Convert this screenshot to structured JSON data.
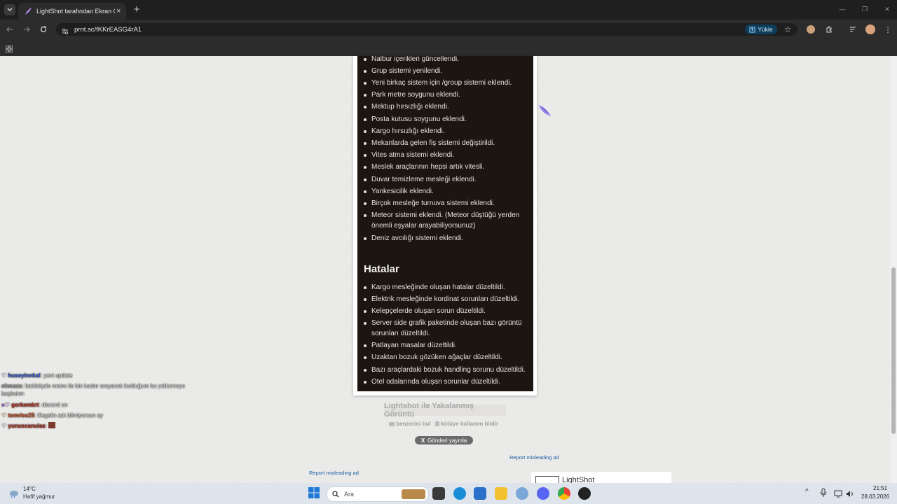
{
  "browser": {
    "tab_title": "LightShot tarafından Ekran Görüntüsü",
    "tab_close": "×",
    "new_tab": "+",
    "url": "prnt.sc/fKKrEASG4rA1",
    "upload_label": "Yükle",
    "window_minimize": "—",
    "window_restore": "❐",
    "window_close": "✕"
  },
  "screenshot": {
    "list1": [
      "Nalbur içerikleri güncellendi.",
      "Grup sistemi yenilendi.",
      "Yeni birkaç sistem için /group sistemi eklendi.",
      "Park metre soygunu eklendi.",
      "Mektup hırsızlığı eklendi.",
      "Posta kutusu soygunu eklendi.",
      "Kargo hırsızlığı eklendi.",
      "Mekanlarda gelen fiş sistemi değiştirildi.",
      "Vites atma sistemi eklendi.",
      "Meslek araçlarının hepsi artık vitesli.",
      "Duvar temizleme mesleği eklendi.",
      "Yankesicilik eklendi.",
      "Birçok mesleğe turnuva sistemi eklendi.",
      "Meteor sistemi eklendi. (Meteor düştüğü yerden önemli eşyalar arayabiliyorsunuz)",
      "Deniz avcılığı sistemi eklendi."
    ],
    "heading2": "Hatalar",
    "list2": [
      "Kargo mesleğinde oluşan hatalar düzeltildi.",
      "Elektrik mesleğinde kordinat sorunları düzeltildi.",
      "Kelepçelerde oluşan sorun düzeltildi.",
      "Server side grafik paketinde oluşan bazı görüntü sorunları düzeltildi.",
      "Patlayan masalar düzeltildi.",
      "Uzaktan bozuk gözüken ağaçlar düzeltildi.",
      "Bazı araçlardaki bozuk handling sorunu düzeltildi.",
      "Otel odalarında oluşan sorunlar düzeltildi."
    ]
  },
  "page": {
    "caption": "Lightshot ile Yakalanmış Görüntü",
    "similar_link": "benzerini bul",
    "abuse_link": "kötüye kullanım bildir",
    "post_button": "Gönderi yayınla",
    "post_button_icon": "X",
    "report_ad_right": "Report misleading ad",
    "report_ad_left": "Report misleading ad",
    "ad_title": "LightShot"
  },
  "chat": [
    {
      "name": "huseyinnksl",
      "text": ": yeni update",
      "name_color": "#3b64d8"
    },
    {
      "name": "efenaza",
      "text": ": kadıköyde metro ile bin kadar arayacak bulduğum bu yıldızmeye başladım",
      "name_color": "#b0b0b0"
    },
    {
      "name": "gorkemkrt",
      "text": ": discord sn",
      "name_color": "#c0392b"
    },
    {
      "name": "tomriss25",
      "text": ": illegalin adı bilmiyorsun ay",
      "name_color": "#d4552a"
    },
    {
      "name": "yunuscanulas",
      "text": ":",
      "name_color": "#c0392b"
    }
  ],
  "taskbar": {
    "weather_temp": "14°C",
    "weather_desc": "Hafif yağmur",
    "search_placeholder": "Ara",
    "time": "21:51",
    "date": "28.03.2026",
    "chevron": "^"
  },
  "colors": {
    "page_bg": "#ececea",
    "screenshot_bg": "#1c1612",
    "link": "#1b5fa5",
    "upload_btn": "#0f3d5c"
  }
}
